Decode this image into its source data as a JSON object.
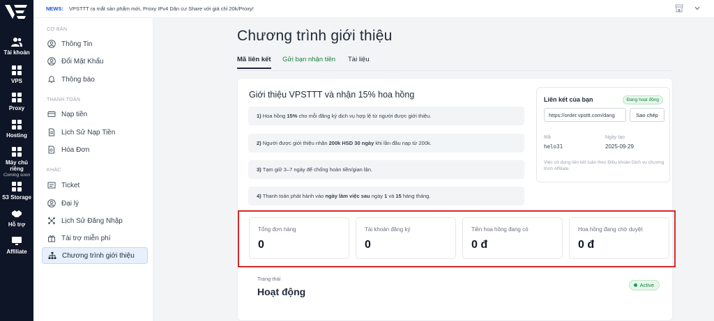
{
  "rail": {
    "items": [
      {
        "label": "Tài khoản",
        "icon": "users-icon"
      },
      {
        "label": "VPS",
        "icon": "grid-icon"
      },
      {
        "label": "Proxy",
        "icon": "grid-icon"
      },
      {
        "label": "Hosting",
        "icon": "grid-icon"
      },
      {
        "label": "Máy chủ riêng",
        "sub": "Coming soon",
        "icon": "grid-icon"
      },
      {
        "label": "S3 Storage",
        "icon": "grid-icon"
      },
      {
        "label": "Hỗ trợ",
        "icon": "handshake-icon"
      },
      {
        "label": "Affiliate",
        "icon": "monitor-icon"
      }
    ]
  },
  "topbar": {
    "news_label": "NEWS:",
    "news_text": "VPSTTT ra mắt sản phẩm mới, Proxy IPv4 Dân cư Share với giá chỉ 20k/Proxy!"
  },
  "sidebar": {
    "sections": [
      "CƠ BẢN",
      "THANH TOÁN",
      "KHÁC"
    ],
    "items": [
      {
        "label": "Thông Tin",
        "icon": "user-circle-icon"
      },
      {
        "label": "Đổi Mật Khẩu",
        "icon": "user-circle-icon"
      },
      {
        "label": "Thông báo",
        "icon": "bell-icon"
      },
      {
        "label": "Nạp tiền",
        "icon": "card-icon"
      },
      {
        "label": "Lịch Sử Nạp Tiền",
        "icon": "document-icon"
      },
      {
        "label": "Hóa Đơn",
        "icon": "document-search-icon"
      },
      {
        "label": "Ticket",
        "icon": "ticket-icon"
      },
      {
        "label": "Đại lý",
        "icon": "user-circle-icon"
      },
      {
        "label": "Lịch Sử Đăng Nhập",
        "icon": "network-icon"
      },
      {
        "label": "Tài trợ miễn phí",
        "icon": "gift-icon"
      },
      {
        "label": "Chương trình giới thiệu",
        "icon": "sitemap-icon"
      }
    ]
  },
  "main": {
    "title": "Chương trình giới thiệu",
    "tabs": [
      {
        "label": "Mã liên kết"
      },
      {
        "label": "Gửi bạn nhận tiền"
      },
      {
        "label": "Tài liệu"
      }
    ],
    "card_title": "Giới thiệu VPSTTT và nhận 15% hoa hồng",
    "rules": [
      {
        "num": "1)",
        "pre": "Hoa hồng",
        "bold": "15%",
        "post": "cho mỗi đăng ký dịch vụ hợp lệ từ người được giới thiệu."
      },
      {
        "num": "2)",
        "pre": "Người được giới thiệu nhận",
        "bold": "200k HSD 30 ngày",
        "post": "khi lần đầu nạp từ 200k."
      },
      {
        "num": "3)",
        "pre": "Tạm giữ 3–7 ngày để chống hoàn tiền/gian lận.",
        "bold": "",
        "post": ""
      },
      {
        "num": "4)",
        "pre": "Thanh toán phát hành vào",
        "bold": "ngày làm việc sau",
        "mid": "ngày",
        "b1": "1",
        "and": "và",
        "b2": "15",
        "post": "hàng tháng."
      }
    ],
    "ref": {
      "title": "Liên kết của bạn",
      "badge": "Đang hoạt động",
      "link": "https://order.vpsttt.com/dang",
      "copy": "Sao chép",
      "code_label": "Mã",
      "code": "helo31",
      "date_label": "Ngày tạo",
      "date": "2025-09-29",
      "note": "Việc sử dụng liên kết tuân theo Điều khoản Dịch vụ chương trình Affiliate."
    },
    "stats": [
      {
        "label": "Tổng đơn hàng",
        "value": "0"
      },
      {
        "label": "Tài khoản đăng ký",
        "value": "0"
      },
      {
        "label": "Tiền hoa hồng đang có",
        "value": "0 đ"
      },
      {
        "label": "Hoa hồng đang chờ duyệt",
        "value": "0 đ"
      }
    ],
    "status": {
      "label": "Trạng thái",
      "value": "Hoạt động",
      "badge": "Active"
    }
  },
  "colors": {
    "rail": "#0d1526",
    "accent_green": "#15803d",
    "highlight_red": "#d62828",
    "active_item_bg": "#e8f0fd"
  }
}
